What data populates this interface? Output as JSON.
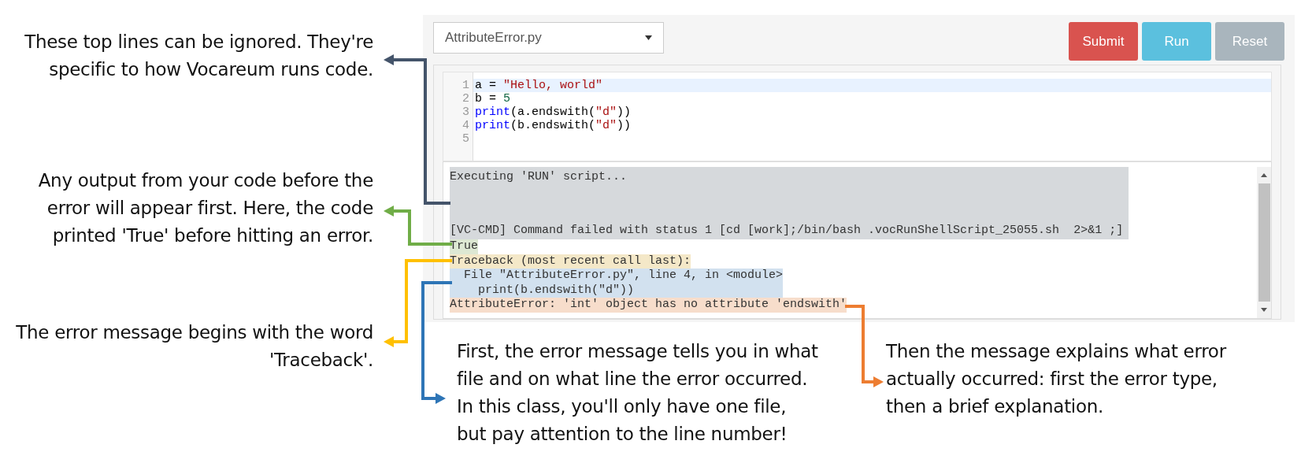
{
  "annotations_left": [
    {
      "text": "These top lines can be ignored. They're specific to how Vocareum runs code.",
      "color": "#44546a"
    },
    {
      "text": "Any output from your code before the error will appear first. Here, the code printed 'True' before hitting an error.",
      "color": "#70ad47"
    },
    {
      "text": "The error message begins with the word 'Traceback'.",
      "color": "#ffc000"
    }
  ],
  "screen": {
    "file_dropdown": {
      "value": "AttributeError.py"
    },
    "buttons": [
      {
        "label": "Submit",
        "color": "#d9534f"
      },
      {
        "label": "Run",
        "color": "#5bc0de"
      },
      {
        "label": "Reset",
        "color": "#a9b5bd"
      }
    ],
    "editor": {
      "lines": [
        {
          "number": "1",
          "selected": true,
          "tokens": [
            {
              "text": "a = ",
              "kind": "plain"
            },
            {
              "text": "\"Hello, world\"",
              "kind": "string"
            }
          ]
        },
        {
          "number": "2",
          "selected": false,
          "tokens": [
            {
              "text": "b = ",
              "kind": "plain"
            },
            {
              "text": "5",
              "kind": "number"
            }
          ]
        },
        {
          "number": "3",
          "selected": false,
          "tokens": [
            {
              "text": "print",
              "kind": "builtin"
            },
            {
              "text": "(a.endswith(",
              "kind": "plain"
            },
            {
              "text": "\"d\"",
              "kind": "string"
            },
            {
              "text": "))",
              "kind": "plain"
            }
          ]
        },
        {
          "number": "4",
          "selected": false,
          "tokens": [
            {
              "text": "print",
              "kind": "builtin"
            },
            {
              "text": "(b.endswith(",
              "kind": "plain"
            },
            {
              "text": "\"d\"",
              "kind": "string"
            },
            {
              "text": "))",
              "kind": "plain"
            }
          ]
        },
        {
          "number": "5",
          "selected": false
        }
      ]
    },
    "output": [
      {
        "kind": "log",
        "color": "#d6d9dc",
        "lines": [
          "Executing 'RUN' script...",
          "[VC-CMD] Command failed with status 1 [cd [work];/bin/bash .vocRunShellScript_25055.sh  2>&1 ;]"
        ]
      },
      {
        "kind": "text",
        "color": "#dde8d3",
        "lines": [
          "True"
        ]
      },
      {
        "kind": "text",
        "color": "#f4e8c8",
        "lines": [
          "Traceback (most recent call last):"
        ]
      },
      {
        "kind": "text",
        "color": "#d2e1ef",
        "lines": [
          "  File \"AttributeError.py\", line 4, in <module>",
          "    print(b.endswith(\"d\"))"
        ]
      },
      {
        "kind": "text",
        "color": "#f7ddcb",
        "lines": [
          "AttributeError: 'int' object has no attribute 'endswith'"
        ]
      }
    ]
  },
  "annotations_bottom": [
    {
      "text": "First, the error message tells you in what file and on what line the error occurred. In this class, you'll only have one file, but pay attention to the line number!",
      "color": "#2e75b6"
    },
    {
      "text": "Then the message explains what error actually occurred: first the error type, then a brief explanation.",
      "color": "#ed7d31"
    }
  ]
}
